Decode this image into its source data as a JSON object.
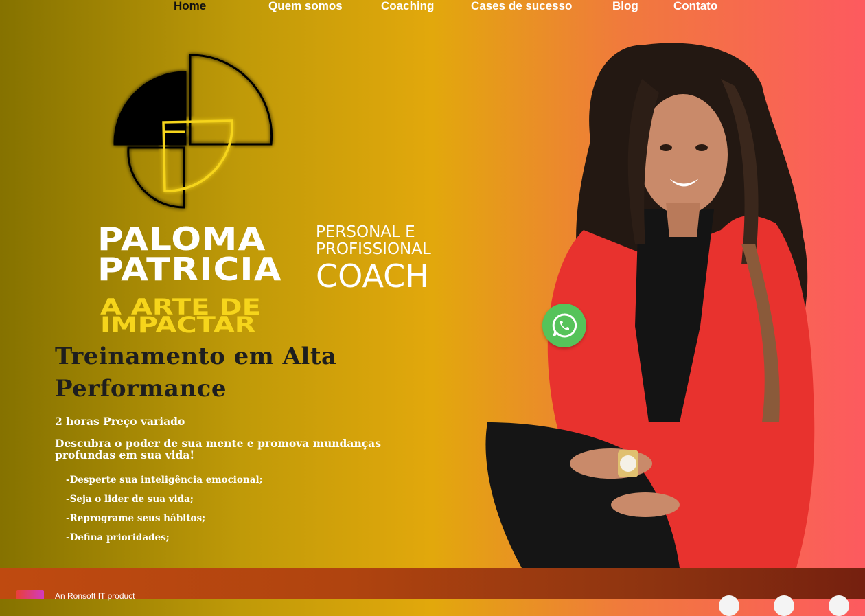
{
  "nav": {
    "items": [
      {
        "label": "Home",
        "active": true
      },
      {
        "label": "Quem somos",
        "active": false
      },
      {
        "label": "Coaching",
        "active": false
      },
      {
        "label": "Cases de sucesso",
        "active": false
      },
      {
        "label": "Blog",
        "active": false
      },
      {
        "label": "Contato",
        "active": false
      }
    ]
  },
  "brand": {
    "name_line1": "PALOMA",
    "name_line2": "PATRICIA",
    "sub_line1": "PERSONAL E",
    "sub_line2": "PROFISSIONAL",
    "coach": "COACH",
    "tagline_line1": "A ARTE DE",
    "tagline_line2": "IMPACTAR"
  },
  "service": {
    "title": "Treinamento em Alta Performance",
    "meta": "2 horas Preço variado",
    "description": "Descubra o poder de sua mente e promova mundanças profundas em sua vida!",
    "bullets": [
      "-Desperte sua inteligência emocional;",
      "-Seja o lider de sua vida;",
      "-Reprograme seus hábitos;",
      "-Defina prioridades;"
    ]
  },
  "whatsapp": {
    "icon": "whatsapp-icon",
    "color": "#56c35a"
  },
  "footer": {
    "credit": "An Ronsoft IT product",
    "social_icons": [
      "social-icon-1",
      "social-icon-2",
      "social-icon-3"
    ]
  },
  "colors": {
    "gradient_left": "#857200",
    "gradient_mid": "#e2a80c",
    "gradient_right": "#fd5a5f",
    "tagline": "#f6d51b",
    "footer": "#b0440f"
  }
}
